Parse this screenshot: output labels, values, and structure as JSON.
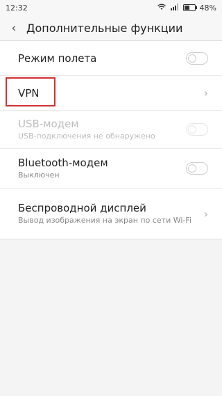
{
  "status_bar": {
    "time": "12:32",
    "battery_percent": "48%"
  },
  "header": {
    "title": "Дополнительные функции"
  },
  "items": [
    {
      "label": "Режим полета",
      "toggle_on": false
    },
    {
      "label": "VPN"
    },
    {
      "label": "USB-модем",
      "sublabel": "USB-подключения не обнаружено",
      "disabled": true,
      "toggle_on": false
    },
    {
      "label": "Bluetooth-модем",
      "sublabel": "Выключен",
      "toggle_on": false
    },
    {
      "label": "Беспроводной дисплей",
      "sublabel": "Вывод изображения на экран по сети Wi-Fi"
    }
  ],
  "highlight_color": "#d32f2f"
}
